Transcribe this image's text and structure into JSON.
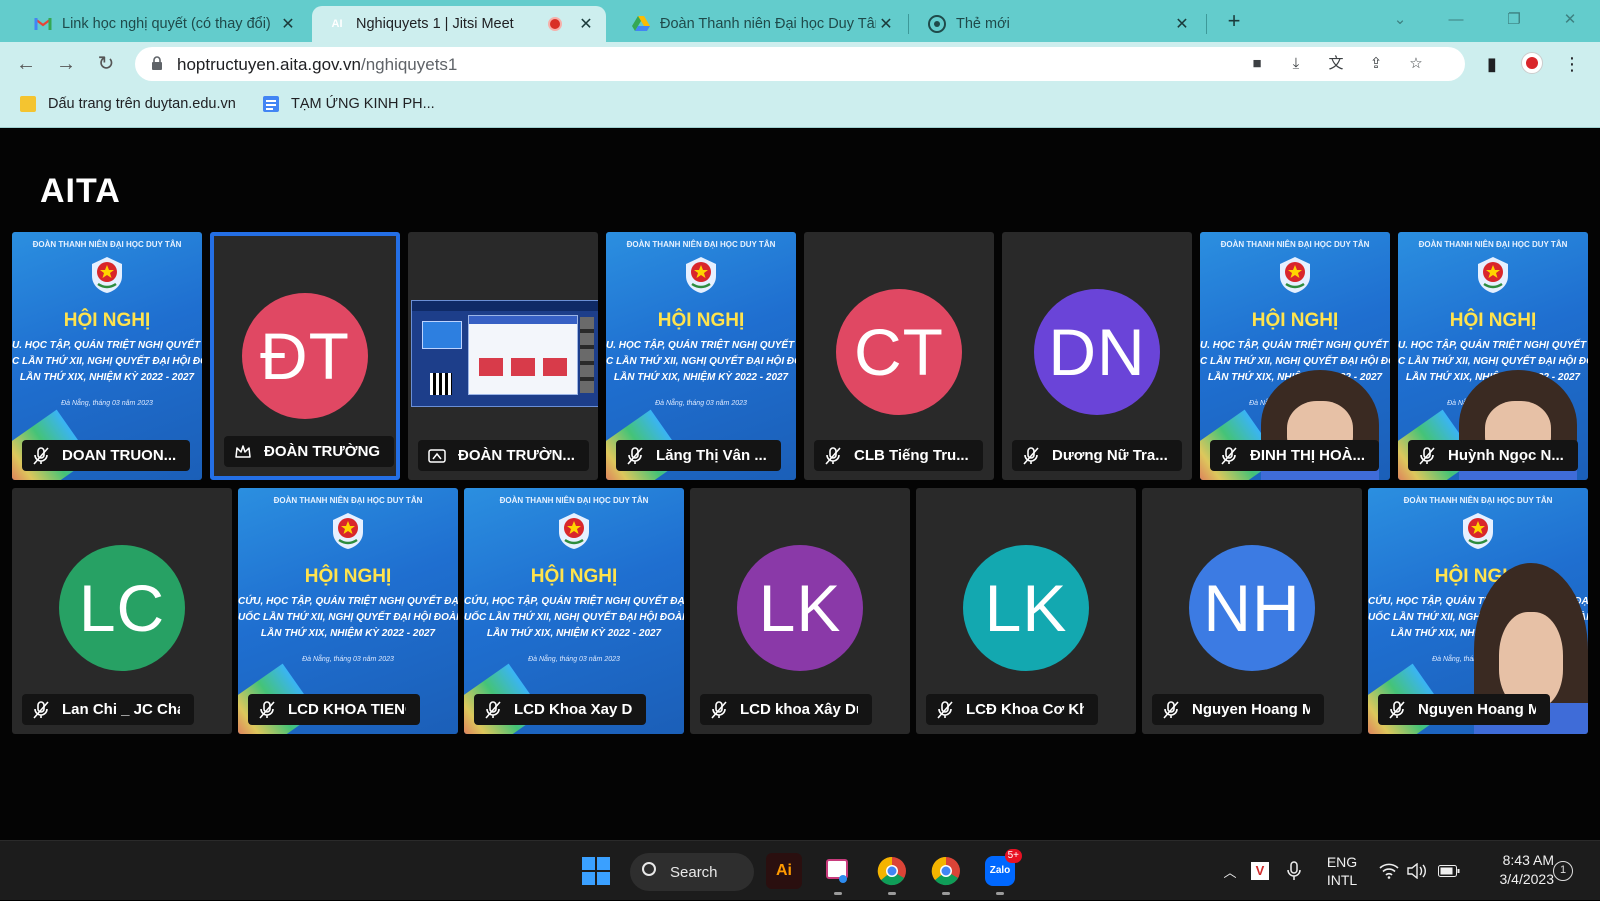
{
  "browser": {
    "tabs": [
      {
        "title": "Link học nghị quyết (có thay đổi)",
        "icon": "gmail-icon"
      },
      {
        "title": "Nghiquyets 1 | Jitsi Meet",
        "icon": "jitsi-icon",
        "recording": true
      },
      {
        "title": "Đoàn Thanh niên Đại học Duy Tân",
        "icon": "google-drive-icon"
      },
      {
        "title": "Thẻ mới",
        "icon": "chrome-icon"
      }
    ],
    "url_host": "hoptructuyen.aita.gov.vn",
    "url_path": "/nghiquyets1",
    "bookmarks": [
      {
        "label": "Dấu trang trên duytan.edu.vn",
        "icon": "folder-icon"
      },
      {
        "label": "TẠM ỨNG KINH PH...",
        "icon": "google-docs-icon"
      }
    ]
  },
  "meeting": {
    "room_title": "AITA",
    "poster": {
      "header": "ĐOÀN THANH NIÊN ĐẠI HỌC DUY TÂN",
      "title": "HỘI NGHỊ",
      "line1": "U. HỌC TẬP, QUÁN TRIỆT NGHỊ QUYẾT ĐẠI",
      "line2": "C LẦN THỨ XII, NGHỊ QUYẾT ĐẠI HỘI ĐOÀN T",
      "line3": "LẦN THỨ XIX, NHIỆM KỲ 2022 - 2027",
      "place": "Đà Nẵng, tháng 03 năm 2023"
    },
    "poster_alt": {
      "line1": "CỨU, HỌC TẬP, QUÁN TRIỆT NGHỊ QUYẾT ĐẠI HỘ",
      "line2": "UỐC LẦN THỨ XII, NGHỊ QUYẾT ĐẠI HỘI ĐOÀN THA",
      "line3": "LẦN THỨ XIX, NHIỆM KỲ 2022 - 2027"
    },
    "participants_row1": [
      {
        "name": "DOAN TRUON...",
        "type": "poster",
        "status": "mic-muted-icon"
      },
      {
        "name": "ĐOÀN TRƯỜNG",
        "type": "avatar",
        "initials": "ĐT",
        "color": "#e04863",
        "status": "moderator-icon",
        "selected": true
      },
      {
        "name": "ĐOÀN TRƯỜN...",
        "type": "screenshare",
        "status": "screen-share-icon"
      },
      {
        "name": "Lăng Thị Vân ...",
        "type": "poster",
        "status": "mic-muted-icon"
      },
      {
        "name": "CLB Tiếng Tru...",
        "type": "avatar",
        "initials": "CT",
        "color": "#e04863",
        "status": "mic-muted-icon"
      },
      {
        "name": "Dương Nữ Tra...",
        "type": "avatar",
        "initials": "DN",
        "color": "#6a44d8",
        "status": "mic-muted-icon"
      },
      {
        "name": "ĐINH THỊ HOÀ...",
        "type": "poster-person",
        "status": "mic-muted-icon"
      },
      {
        "name": "Huỳnh Ngọc N...",
        "type": "poster-person",
        "status": "mic-muted-icon"
      }
    ],
    "participants_row2": [
      {
        "name": "Lan Chi _ JC Chan...",
        "type": "avatar",
        "initials": "LC",
        "color": "#27a164",
        "status": "mic-muted-icon"
      },
      {
        "name": "LCD KHOA TIENG ...",
        "type": "poster",
        "status": "mic-muted-icon"
      },
      {
        "name": "LCD Khoa Xay Dung",
        "type": "poster",
        "status": "mic-muted-icon"
      },
      {
        "name": "LCD khoa Xây Dựng",
        "type": "avatar",
        "initials": "LK",
        "color": "#8a39a8",
        "status": "mic-muted-icon"
      },
      {
        "name": "LCĐ Khoa Cơ Khí ...",
        "type": "avatar",
        "initials": "LK",
        "color": "#13a8b0",
        "status": "mic-muted-icon"
      },
      {
        "name": "Nguyen Hoang Mi...",
        "type": "avatar",
        "initials": "NH",
        "color": "#3c7be3",
        "status": "mic-muted-icon"
      },
      {
        "name": "Nguyen Hoang Mi...",
        "type": "poster-person",
        "status": "mic-muted-icon"
      }
    ]
  },
  "taskbar": {
    "search_label": "Search",
    "apps": [
      "windows-start-icon",
      "illustrator-icon",
      "snipping-tool-icon",
      "chrome-icon",
      "chrome-icon",
      "zalo-icon"
    ],
    "zalo_badge": "5+",
    "language_line1": "ENG",
    "language_line2": "INTL",
    "time": "8:43 AM",
    "date": "3/4/2023",
    "notifications": "1"
  }
}
